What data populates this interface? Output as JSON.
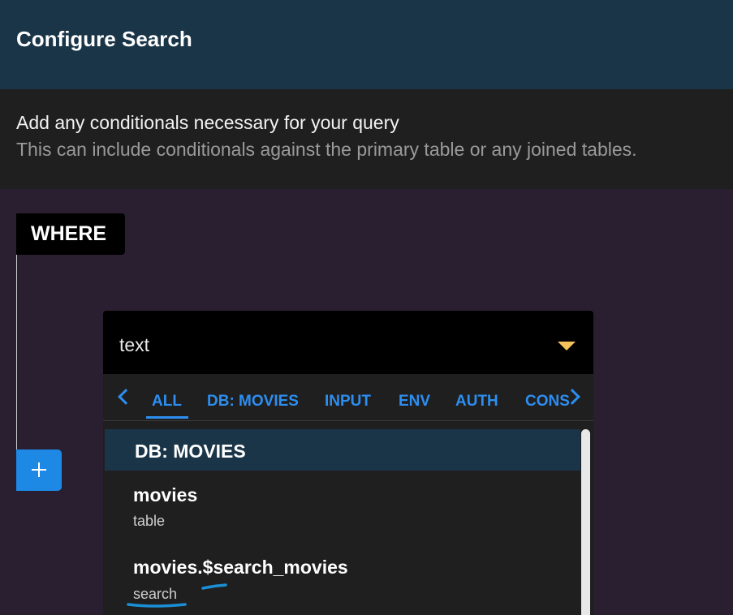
{
  "header": {
    "title": "Configure Search"
  },
  "description": {
    "main": "Add any conditionals necessary for your query",
    "sub": "This can include conditionals against the primary table or any joined tables."
  },
  "where": {
    "label": "WHERE",
    "add_icon": "plus-icon"
  },
  "select": {
    "value": "text",
    "caret_icon": "chevron-down-icon"
  },
  "tabs": [
    {
      "label": "ALL",
      "active": true
    },
    {
      "label": "DB: MOVIES"
    },
    {
      "label": "INPUT"
    },
    {
      "label": "ENV"
    },
    {
      "label": "AUTH"
    },
    {
      "label": "CONSTANTS"
    }
  ],
  "list": {
    "group": "DB: MOVIES",
    "items": [
      {
        "name": "movies",
        "type": "table"
      },
      {
        "name": "movies.$search_movies",
        "type": "search"
      }
    ]
  },
  "colors": {
    "header_bg": "#1b3548",
    "accent": "#1e88e5",
    "caret": "#f5c15a",
    "annotation": "#1a8fd6"
  }
}
